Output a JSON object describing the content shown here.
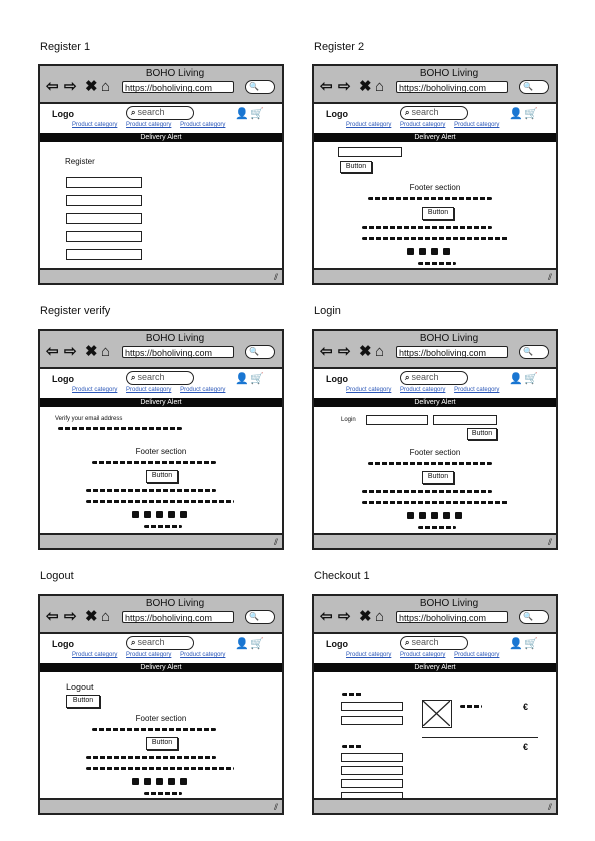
{
  "browser": {
    "title": "BOHO Living",
    "url": "https://boholiving.com",
    "browser_search_glyph": "🔍"
  },
  "header": {
    "logo": "Logo",
    "search_placeholder": "search",
    "categories": [
      "Product category",
      "Product category",
      "Product category"
    ],
    "delivery_alert": "Delivery Alert"
  },
  "captions": {
    "register1": "Register 1",
    "register2": "Register 2",
    "register_verify": "Register verify",
    "login": "Login",
    "logout": "Logout",
    "checkout1": "Checkout 1"
  },
  "register1": {
    "heading": "Register"
  },
  "register2": {
    "button": "Button",
    "footer_title": "Footer section",
    "footer_button": "Button"
  },
  "register_verify": {
    "message": "Verify your email address",
    "footer_title": "Footer section",
    "footer_button": "Button"
  },
  "login": {
    "label": "Login",
    "button": "Button",
    "footer_title": "Footer section",
    "footer_button": "Button"
  },
  "logout": {
    "heading": "Logout",
    "button": "Button",
    "footer_title": "Footer section",
    "footer_button": "Button"
  },
  "checkout1": {
    "currency1": "€",
    "currency2": "€"
  }
}
